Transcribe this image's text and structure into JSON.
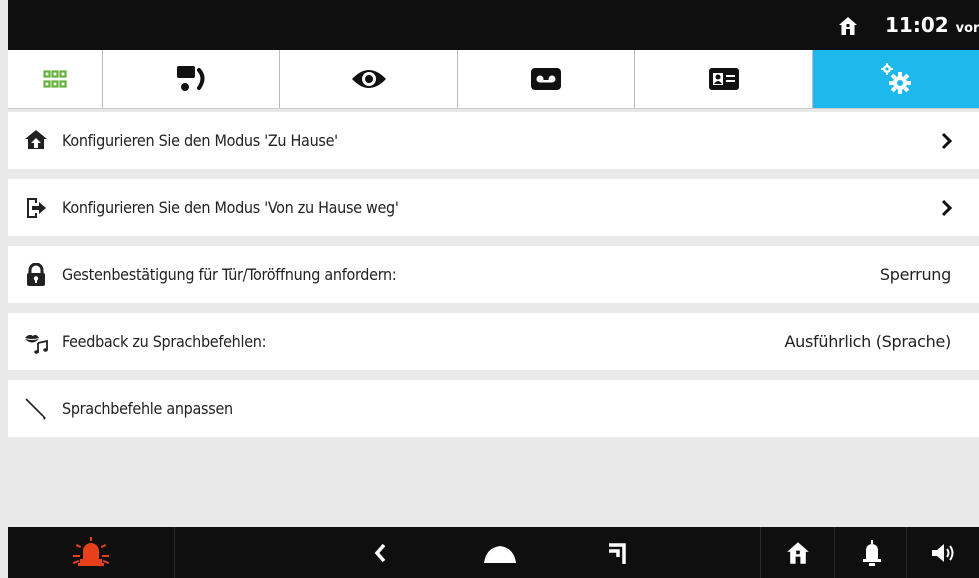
{
  "status_bar": {
    "time": "11:02",
    "ampm": "vorm",
    "home_icon": "home-icon"
  },
  "tabs": [
    {
      "icon": "apps-grid-icon",
      "active": false
    },
    {
      "icon": "intercom-call-icon",
      "active": false
    },
    {
      "icon": "eye-icon",
      "active": false
    },
    {
      "icon": "voicemail-icon",
      "active": false
    },
    {
      "icon": "contact-card-icon",
      "active": false
    },
    {
      "icon": "settings-gears-icon",
      "active": true
    }
  ],
  "settings": [
    {
      "label": "Konfigurieren Sie den Modus 'Zu Hause'",
      "icon": "home-arrow-icon",
      "value": "",
      "has_chevron": true
    },
    {
      "label": "Konfigurieren Sie den Modus 'Von zu Hause weg'",
      "icon": "exit-door-icon",
      "value": "",
      "has_chevron": true
    },
    {
      "label": "Gestenbestätigung für Tür/Toröffnung anfordern:",
      "icon": "lock-icon",
      "value": "Sperrung",
      "has_chevron": false
    },
    {
      "label": "Feedback zu Sprachbefehlen:",
      "icon": "lips-music-icon",
      "value": "Ausführlich (Sprache)",
      "has_chevron": false
    },
    {
      "label": "Sprachbefehle anpassen",
      "icon": "brush-icon",
      "value": "",
      "has_chevron": false
    }
  ],
  "bottom_bar": [
    {
      "icon": "alarm-siren-icon"
    },
    {
      "icon": "back-chevron-icon"
    },
    {
      "icon": "home-dome-icon"
    },
    {
      "icon": "recent-apps-icon"
    },
    {
      "icon": "home-icon"
    },
    {
      "icon": "bell-icon"
    },
    {
      "icon": "speaker-volume-icon"
    }
  ],
  "colors": {
    "accent": "#1db9ec",
    "green": "#64b03a",
    "alarm": "#e8401c",
    "bar": "#0f0f0f"
  }
}
